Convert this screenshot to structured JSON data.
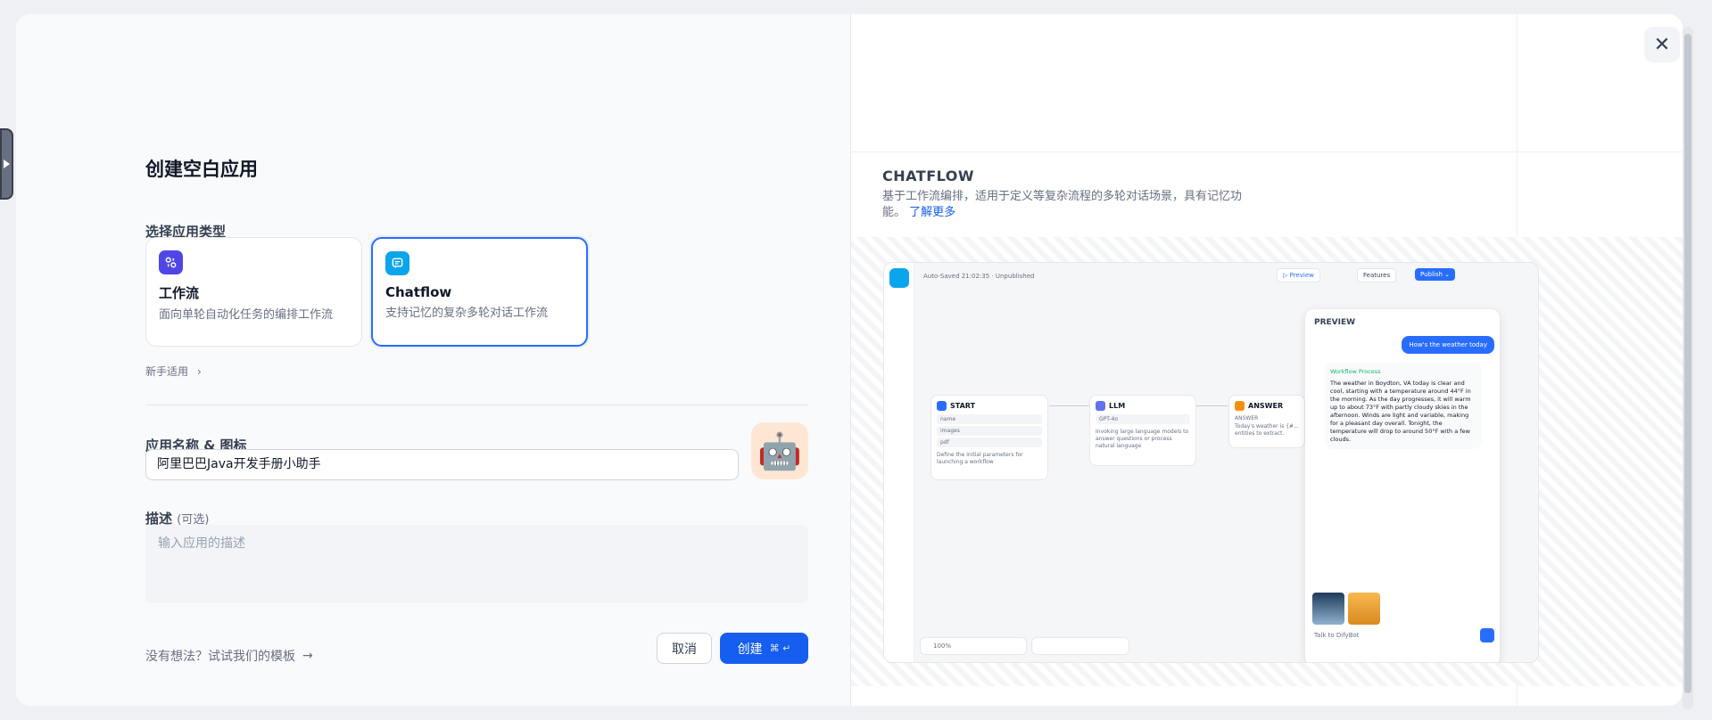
{
  "dialog": {
    "title": "创建空白应用",
    "type_section_label": "选择应用类型",
    "app_types": [
      {
        "name": "工作流",
        "desc": "面向单轮自动化任务的编排工作流",
        "selected": false,
        "icon": "workflow-icon",
        "color": "#4f46e5"
      },
      {
        "name": "Chatflow",
        "desc": "支持记忆的复杂多轮对话工作流",
        "selected": true,
        "icon": "chatflow-icon",
        "color": "#0ba5ec"
      }
    ],
    "beginner_label": "新手适用",
    "name_section_label": "应用名称 & 图标",
    "name_value": "阿里巴巴Java开发手册小助手",
    "app_icon_emoji": "🤖",
    "desc_label": "描述",
    "desc_optional": "(可选)",
    "desc_placeholder": "输入应用的描述",
    "template_link": "没有想法？试试我们的模板",
    "cancel_label": "取消",
    "create_label": "创建",
    "create_shortcut": "⌘ ↵"
  },
  "preview": {
    "type_title": "CHATFLOW",
    "description": "基于工作流编排，适用于定义等复杂流程的多轮对话场景，具有记忆功能。",
    "learn_more": "了解更多",
    "screenshot": {
      "autosave": "Auto-Saved 21:02:35 · Unpublished",
      "btn_preview": "▷ Preview",
      "btn_features": "Features",
      "btn_publish": "Publish ⌄",
      "panel_title": "PREVIEW",
      "user_msg": "How's the weather today",
      "workflow_process": "Workflow Process",
      "bot_msg": "The weather in Boydton, VA today is clear and cool, starting with a temperature around 44°F in the morning. As the day progresses, it will warm up to about 73°F with partly cloudy skies in the afternoon. Winds are light and variable, making for a pleasant day overall. Tonight, the temperature will drop to around 50°F with a few clouds.",
      "input_placeholder": "Talk to DifyBot",
      "zoom": "100%",
      "nodes": [
        {
          "title": "START",
          "lines": [
            "name",
            "images",
            "pdf"
          ],
          "desc": "Define the initial parameters for launching a workflow"
        },
        {
          "title": "LLM",
          "lines": [
            "GPT-4o"
          ],
          "desc": "Invoking large language models to answer questions or process natural language"
        },
        {
          "title": "ANSWER",
          "lines": [
            "ANSWER"
          ],
          "desc": "Today's weather is {#... entities to extract."
        }
      ]
    }
  },
  "colors": {
    "primary": "#155eef",
    "selected_border": "#296dff"
  }
}
